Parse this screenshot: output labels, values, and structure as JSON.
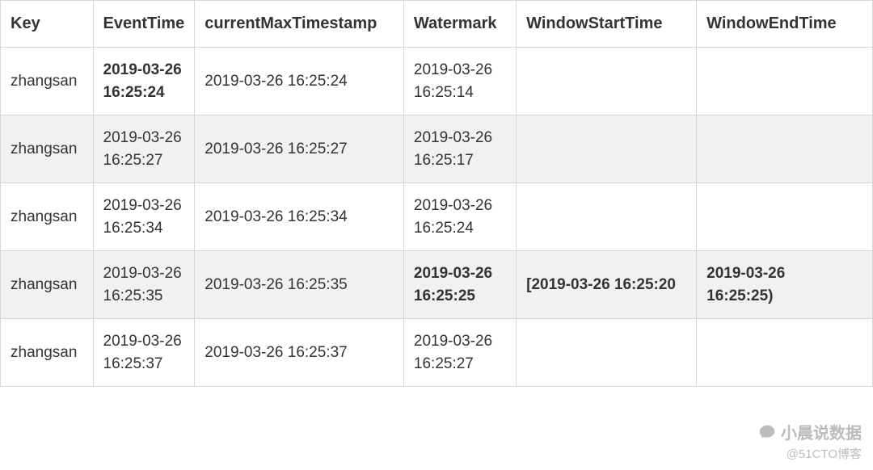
{
  "table": {
    "headers": {
      "key": "Key",
      "event_time": "EventTime",
      "current_max": "currentMaxTimestamp",
      "watermark": "Watermark",
      "window_start": "WindowStartTime",
      "window_end": "WindowEndTime"
    },
    "rows": [
      {
        "key": "zhangsan",
        "event_time": "2019-03-26 16:25:24",
        "event_time_bold": true,
        "current_max": "2019-03-26 16:25:24",
        "watermark": "2019-03-26 16:25:14",
        "watermark_bold": false,
        "window_start": "",
        "window_start_bold": false,
        "window_end": "",
        "window_end_bold": false
      },
      {
        "key": "zhangsan",
        "event_time": "2019-03-26 16:25:27",
        "event_time_bold": false,
        "current_max": "2019-03-26 16:25:27",
        "watermark": "2019-03-26 16:25:17",
        "watermark_bold": false,
        "window_start": "",
        "window_start_bold": false,
        "window_end": "",
        "window_end_bold": false
      },
      {
        "key": "zhangsan",
        "event_time": "2019-03-26 16:25:34",
        "event_time_bold": false,
        "current_max": "2019-03-26 16:25:34",
        "watermark": "2019-03-26 16:25:24",
        "watermark_bold": false,
        "window_start": "",
        "window_start_bold": false,
        "window_end": "",
        "window_end_bold": false
      },
      {
        "key": "zhangsan",
        "event_time": "2019-03-26 16:25:35",
        "event_time_bold": false,
        "current_max": "2019-03-26 16:25:35",
        "watermark": "2019-03-26 16:25:25",
        "watermark_bold": true,
        "window_start": "[2019-03-26 16:25:20",
        "window_start_bold": true,
        "window_end": "2019-03-26 16:25:25)",
        "window_end_bold": true
      },
      {
        "key": "zhangsan",
        "event_time": "2019-03-26 16:25:37",
        "event_time_bold": false,
        "current_max": "2019-03-26 16:25:37",
        "watermark": "2019-03-26 16:25:27",
        "watermark_bold": false,
        "window_start": "",
        "window_start_bold": false,
        "window_end": "",
        "window_end_bold": false
      }
    ]
  },
  "overlay": {
    "author": "小晨说数据",
    "source": "@51CTO博客"
  }
}
